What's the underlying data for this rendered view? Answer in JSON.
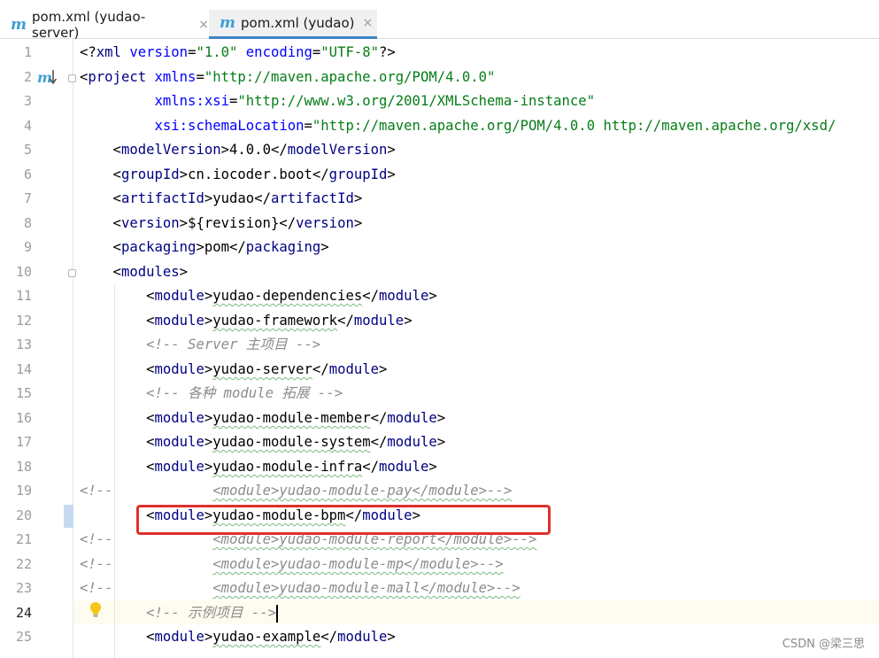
{
  "tabs": [
    {
      "icon": "m",
      "label": "pom.xml (yudao-server)",
      "close": "×",
      "active": false
    },
    {
      "icon": "m",
      "label": "pom.xml (yudao)",
      "close": "×",
      "active": true
    }
  ],
  "gutter": {
    "line_numbers": [
      "1",
      "2",
      "3",
      "4",
      "5",
      "6",
      "7",
      "8",
      "9",
      "10",
      "11",
      "12",
      "13",
      "14",
      "15",
      "16",
      "17",
      "18",
      "19",
      "20",
      "21",
      "22",
      "23",
      "24",
      "25"
    ],
    "current_line": "24",
    "maven_marker": "m",
    "icons": {
      "maven": "maven-m-icon",
      "jump": "arrow-down-icon",
      "fold": "fold-icon",
      "hint": "lightbulb-icon"
    }
  },
  "code": {
    "l1_open": "<?",
    "l1_tag": "xml",
    "l1_attr1": "version",
    "l1_val1": "\"1.0\"",
    "l1_attr2": "encoding",
    "l1_val2": "\"UTF-8\"",
    "l1_close": "?>",
    "l2_tag": "project",
    "l2_attr": "xmlns",
    "l2_val": "\"http://maven.apache.org/POM/4.0.0\"",
    "l3_attr": "xmlns:xsi",
    "l3_val": "\"http://www.w3.org/2001/XMLSchema-instance\"",
    "l4_attr": "xsi:schemaLocation",
    "l4_val": "\"http://maven.apache.org/POM/4.0.0 http://maven.apache.org/xsd/",
    "tag_modelVersion": "modelVersion",
    "val_modelVersion": "4.0.0",
    "tag_groupId": "groupId",
    "val_groupId": "cn.iocoder.boot",
    "tag_artifactId": "artifactId",
    "val_artifactId": "yudao",
    "tag_version": "version",
    "val_version": "${revision}",
    "tag_packaging": "packaging",
    "val_packaging": "pom",
    "tag_modules": "modules",
    "tag_module": "module",
    "m_dependencies": "yudao-dependencies",
    "m_framework": "yudao-framework",
    "comment_server": "<!-- Server 主项目 -->",
    "m_server": "yudao-server",
    "comment_modules": "<!-- 各种 module 拓展 -->",
    "m_member": "yudao-module-member",
    "m_system": "yudao-module-system",
    "m_infra": "yudao-module-infra",
    "comment_prefix": "<!--",
    "c_pay_line": "<module>yudao-module-pay</module>-->",
    "m_bpm": "yudao-module-bpm",
    "c_report_line": "<module>yudao-module-report</module>-->",
    "c_mp_line": "<module>yudao-module-mp</module>-->",
    "c_mall_line": "<module>yudao-module-mall</module>-->",
    "comment_example": "<!-- 示例项目 -->",
    "m_example": "yudao-example"
  },
  "watermark": "CSDN @梁三思",
  "colors": {
    "tag": "#000080",
    "attribute": "#0000ff",
    "string": "#067d17",
    "comment": "#8c8c8c",
    "highlight_box": "#e0302b",
    "current_line_bg": "#fefcf0"
  }
}
